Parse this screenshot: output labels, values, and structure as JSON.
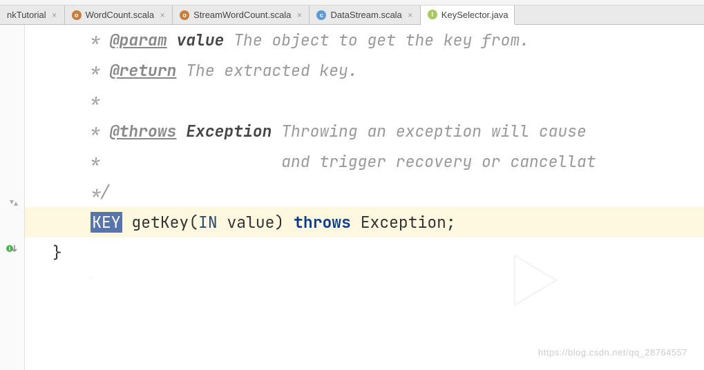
{
  "tabs": [
    {
      "label": "nkTutorial"
    },
    {
      "label": "WordCount.scala"
    },
    {
      "label": "StreamWordCount.scala"
    },
    {
      "label": "DataStream.scala"
    },
    {
      "label": "KeySelector.java"
    }
  ],
  "code": {
    "l1_tag": "@param",
    "l1_name": "value",
    "l1_text": " The object to get the key from.",
    "l2_tag": "@return",
    "l2_text": " The extracted key.",
    "l4_tag": "@throws",
    "l4_name": "Exception",
    "l4_text": " Throwing an exception will cause ",
    "l5_text": "and trigger recovery or cancellat",
    "l7_type_key": "KEY",
    "l7_method": "getKey",
    "l7_type_in": "IN",
    "l7_param": "value",
    "l7_throws": "throws",
    "l7_exception": "Exception",
    "l8_brace": "}"
  },
  "watermark": "https://blog.csdn.net/qq_28764557"
}
